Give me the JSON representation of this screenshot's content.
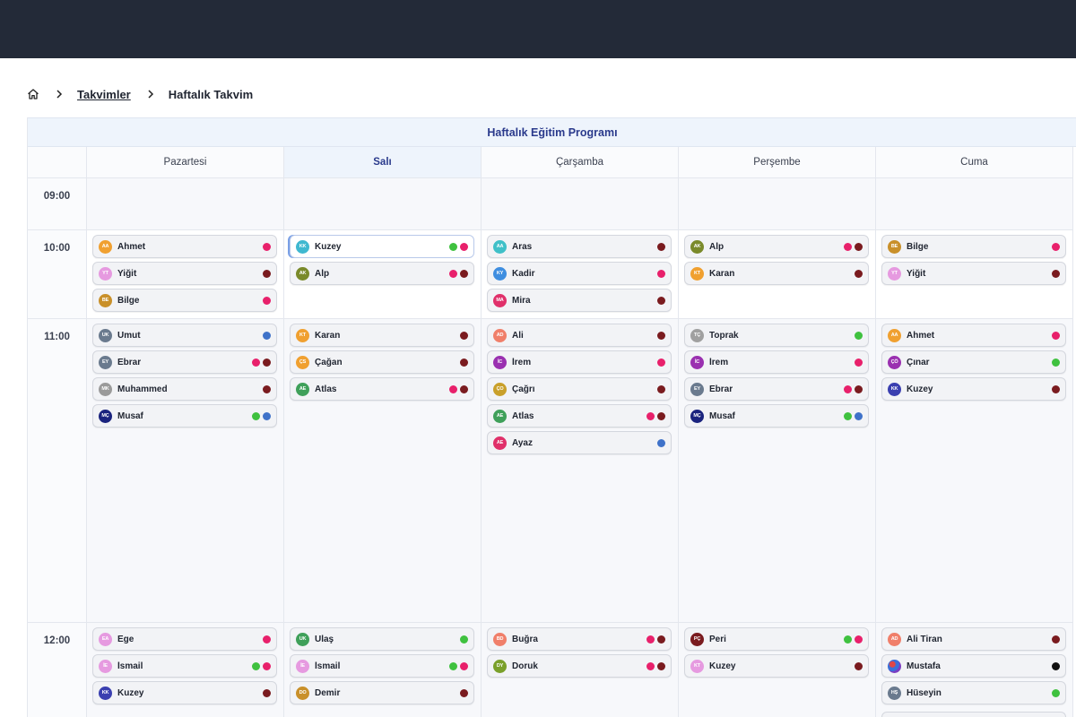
{
  "breadcrumb": {
    "home_icon": "home-icon",
    "separator_icon": "chevron-right-icon",
    "link": "Takvimler",
    "current": "Haftalık Takvim"
  },
  "calendar": {
    "title": "Haftalık Eğitim Programı",
    "days": [
      "Pazartesi",
      "Salı",
      "Çarşamba",
      "Perşembe",
      "Cuma"
    ],
    "active_day": "Salı",
    "times": [
      "09:00",
      "10:00",
      "11:00",
      "12:00"
    ]
  },
  "colors": {
    "pink": "#e8206b",
    "maroon": "#7a1b1f",
    "green": "#3fc13f",
    "blue": "#3f72c9",
    "black": "#111111",
    "active_header": "#eef4fc",
    "accent_text": "#2a3a8c"
  },
  "slots": {
    "10:00": [
      [
        {
          "initials": "AA",
          "name": "Ahmet",
          "avatar": "#f0a030",
          "dots": [
            "pink"
          ]
        },
        {
          "initials": "YT",
          "name": "Yiğit",
          "avatar": "#e69ae0",
          "dots": [
            "maroon"
          ]
        },
        {
          "initials": "BE",
          "name": "Bilge",
          "avatar": "#c9902a",
          "dots": [
            "pink"
          ]
        }
      ],
      [
        {
          "initials": "KK",
          "name": "Kuzey",
          "avatar": "#3fb8d0",
          "dots": [
            "green",
            "pink"
          ],
          "selected": true
        },
        {
          "initials": "AK",
          "name": "Alp",
          "avatar": "#7a8a2a",
          "dots": [
            "pink",
            "maroon"
          ]
        }
      ],
      [
        {
          "initials": "AA",
          "name": "Aras",
          "avatar": "#3fc0c8",
          "dots": [
            "maroon"
          ]
        },
        {
          "initials": "KY",
          "name": "Kadir",
          "avatar": "#3f8ee0",
          "dots": [
            "pink"
          ]
        },
        {
          "initials": "MA",
          "name": "Mira",
          "avatar": "#e0306a",
          "dots": [
            "maroon"
          ]
        }
      ],
      [
        {
          "initials": "AK",
          "name": "Alp",
          "avatar": "#7a8a2a",
          "dots": [
            "pink",
            "maroon"
          ]
        },
        {
          "initials": "KT",
          "name": "Karan",
          "avatar": "#f0a030",
          "dots": [
            "maroon"
          ]
        }
      ],
      [
        {
          "initials": "BE",
          "name": "Bilge",
          "avatar": "#c9902a",
          "dots": [
            "pink"
          ]
        },
        {
          "initials": "YT",
          "name": "Yiğit",
          "avatar": "#e69ae0",
          "dots": [
            "maroon"
          ]
        }
      ]
    ],
    "11:00": [
      [
        {
          "initials": "UK",
          "name": "Umut",
          "avatar": "#6a7a8e",
          "dots": [
            "blue"
          ]
        },
        {
          "initials": "EY",
          "name": "Ebrar",
          "avatar": "#6a7a8e",
          "dots": [
            "pink",
            "maroon"
          ]
        },
        {
          "initials": "MK",
          "name": "Muhammed",
          "avatar": "#9a9a9a",
          "dots": [
            "maroon"
          ]
        },
        {
          "initials": "MÇ",
          "name": "Musaf",
          "avatar": "#1a237e",
          "dots": [
            "green",
            "blue"
          ]
        }
      ],
      [
        {
          "initials": "KT",
          "name": "Karan",
          "avatar": "#f0a030",
          "dots": [
            "maroon"
          ]
        },
        {
          "initials": "ÇS",
          "name": "Çağan",
          "avatar": "#f0a030",
          "dots": [
            "maroon"
          ]
        },
        {
          "initials": "AE",
          "name": "Atlas",
          "avatar": "#3fa05a",
          "dots": [
            "pink",
            "maroon"
          ]
        }
      ],
      [
        {
          "initials": "AD",
          "name": "Ali",
          "avatar": "#f07f6a",
          "dots": [
            "maroon"
          ]
        },
        {
          "initials": "İC",
          "name": "İrem",
          "avatar": "#9a30b0",
          "dots": [
            "pink"
          ]
        },
        {
          "initials": "ÇO",
          "name": "Çağrı",
          "avatar": "#c9a02a",
          "dots": [
            "maroon"
          ]
        },
        {
          "initials": "AE",
          "name": "Atlas",
          "avatar": "#3fa05a",
          "dots": [
            "pink",
            "maroon"
          ]
        },
        {
          "initials": "AE",
          "name": "Ayaz",
          "avatar": "#e0306a",
          "dots": [
            "blue"
          ]
        }
      ],
      [
        {
          "initials": "TÇ",
          "name": "Toprak",
          "avatar": "#a0a0a0",
          "dots": [
            "green"
          ]
        },
        {
          "initials": "İC",
          "name": "İrem",
          "avatar": "#9a30b0",
          "dots": [
            "pink"
          ]
        },
        {
          "initials": "EY",
          "name": "Ebrar",
          "avatar": "#6a7a8e",
          "dots": [
            "pink",
            "maroon"
          ]
        },
        {
          "initials": "MÇ",
          "name": "Musaf",
          "avatar": "#1a237e",
          "dots": [
            "green",
            "blue"
          ]
        }
      ],
      [
        {
          "initials": "AA",
          "name": "Ahmet",
          "avatar": "#f0a030",
          "dots": [
            "pink"
          ]
        },
        {
          "initials": "ÇÖ",
          "name": "Çınar",
          "avatar": "#9a30b0",
          "dots": [
            "green"
          ]
        },
        {
          "initials": "KK",
          "name": "Kuzey",
          "avatar": "#3a3fb0",
          "dots": [
            "maroon"
          ]
        }
      ]
    ],
    "12:00": [
      [
        {
          "initials": "EA",
          "name": "Ege",
          "avatar": "#e69ae0",
          "dots": [
            "pink"
          ]
        },
        {
          "initials": "İE",
          "name": "İsmail",
          "avatar": "#e69ae0",
          "dots": [
            "green",
            "pink"
          ]
        },
        {
          "initials": "KK",
          "name": "Kuzey",
          "avatar": "#3a3fb0",
          "dots": [
            "maroon"
          ]
        }
      ],
      [
        {
          "initials": "UK",
          "name": "Ulaş",
          "avatar": "#3fa05a",
          "dots": [
            "green"
          ]
        },
        {
          "initials": "İE",
          "name": "İsmail",
          "avatar": "#e69ae0",
          "dots": [
            "green",
            "pink"
          ]
        },
        {
          "initials": "DO",
          "name": "Demir",
          "avatar": "#c9902a",
          "dots": [
            "maroon"
          ]
        }
      ],
      [
        {
          "initials": "BD",
          "name": "Buğra",
          "avatar": "#f07f6a",
          "dots": [
            "pink",
            "maroon"
          ]
        },
        {
          "initials": "DY",
          "name": "Doruk",
          "avatar": "#7aa02a",
          "dots": [
            "pink",
            "maroon"
          ]
        }
      ],
      [
        {
          "initials": "PÇ",
          "name": "Peri",
          "avatar": "#7a1b1f",
          "dots": [
            "green",
            "pink"
          ]
        },
        {
          "initials": "KT",
          "name": "Kuzey",
          "avatar": "#e69ae0",
          "dots": [
            "maroon"
          ]
        }
      ],
      [
        {
          "initials": "AD",
          "name": "Ali Tiran",
          "avatar": "#f07f6a",
          "dots": [
            "maroon"
          ]
        },
        {
          "initials": "",
          "name": "Mustafa",
          "avatar": "globe",
          "dots": [
            "black"
          ]
        },
        {
          "initials": "HŞ",
          "name": "Hüseyin",
          "avatar": "#6a7a8e",
          "dots": [
            "green"
          ]
        }
      ]
    ]
  }
}
